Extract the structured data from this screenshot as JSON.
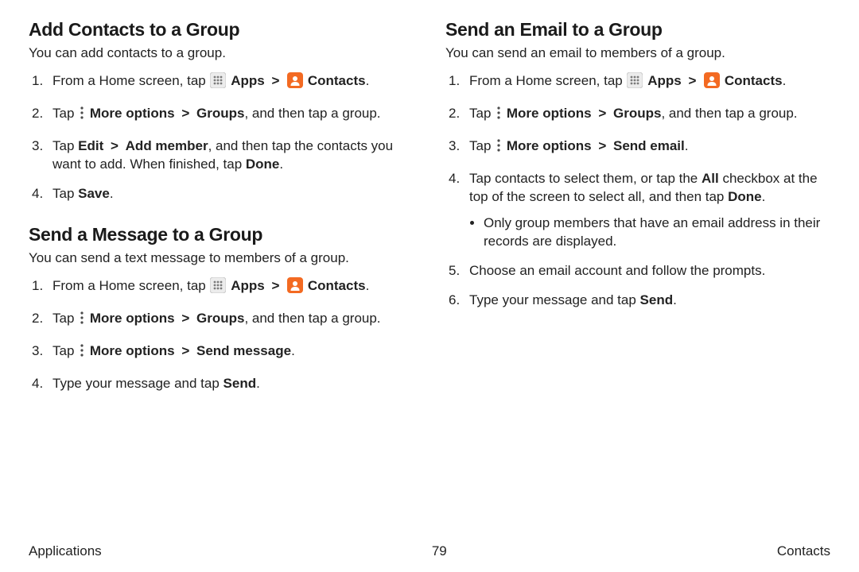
{
  "left": {
    "section1": {
      "title": "Add Contacts to a Group",
      "intro": "You can add contacts to a group.",
      "steps": {
        "s1a": "From a Home screen, tap ",
        "apps": "Apps",
        "gt1": ">",
        "contacts": "Contacts",
        "s1end": ".",
        "s2a": "Tap ",
        "moreopt": "More options",
        "gt2": ">",
        "groups": "Groups",
        "s2b": ", and then tap a group.",
        "s3a": "Tap ",
        "edit": "Edit",
        "gt3": ">",
        "addmember": "Add member",
        "s3b": ", and then tap the contacts you want to add. When finished, tap ",
        "done": "Done",
        "s3end": ".",
        "s4a": "Tap ",
        "save": "Save",
        "s4end": "."
      }
    },
    "section2": {
      "title": "Send a Message to a Group",
      "intro": "You can send a text message to members of a group.",
      "steps": {
        "s1a": "From a Home screen, tap ",
        "apps": "Apps",
        "gt1": ">",
        "contacts": "Contacts",
        "s1end": ".",
        "s2a": "Tap ",
        "moreopt": "More options",
        "gt2": ">",
        "groups": "Groups",
        "s2b": ", and then tap a group.",
        "s3a": "Tap ",
        "moreopt2": "More options",
        "gt3": ">",
        "sendmsg": "Send message",
        "s3end": ".",
        "s4a": "Type your message and tap ",
        "send": "Send",
        "s4end": "."
      }
    }
  },
  "right": {
    "section1": {
      "title": "Send an Email to a Group",
      "intro": "You can send an email to members of a group.",
      "steps": {
        "s1a": "From a Home screen, tap ",
        "apps": "Apps",
        "gt1": ">",
        "contacts": "Contacts",
        "s1end": ".",
        "s2a": "Tap ",
        "moreopt": "More options",
        "gt2": ">",
        "groups": "Groups",
        "s2b": ", and then tap a group.",
        "s3a": "Tap ",
        "moreopt2": "More options",
        "gt3": ">",
        "sendemail": "Send email",
        "s3end": ".",
        "s4a": "Tap contacts to select them, or tap the ",
        "all": "All",
        "s4b": " checkbox at the top of the screen to select all, and then tap ",
        "done": "Done",
        "s4end": ".",
        "bullet1": "Only group members that have an email address in their records are displayed.",
        "s5": "Choose an email account and follow the prompts.",
        "s6a": "Type your message and tap ",
        "send": "Send",
        "s6end": "."
      }
    }
  },
  "footer": {
    "left": "Applications",
    "page": "79",
    "right": "Contacts"
  },
  "colors": {
    "accentOrange": "#f36a22",
    "iconGray": "#e4e4e4",
    "iconDotGray": "#7b7b7b"
  }
}
